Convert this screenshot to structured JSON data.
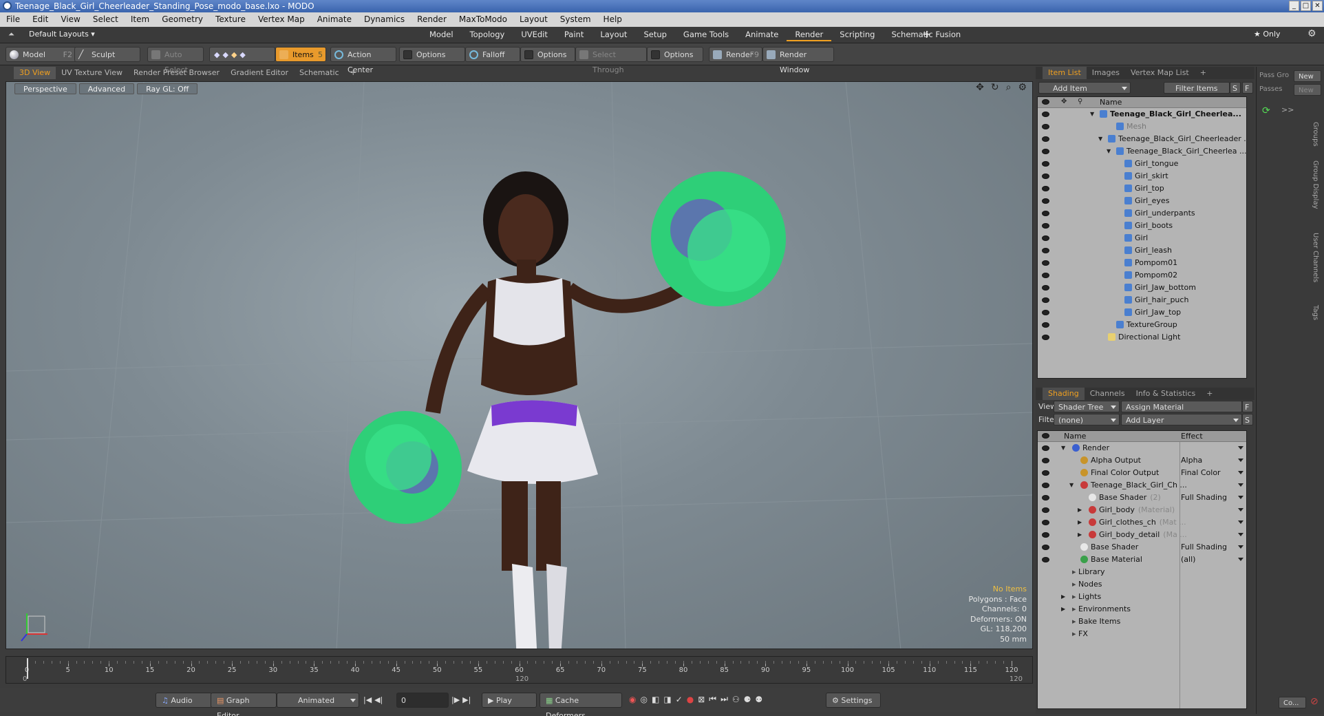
{
  "window": {
    "title": "Teenage_Black_Girl_Cheerleader_Standing_Pose_modo_base.lxo - MODO"
  },
  "menu": [
    "File",
    "Edit",
    "View",
    "Select",
    "Item",
    "Geometry",
    "Texture",
    "Vertex Map",
    "Animate",
    "Dynamics",
    "Render",
    "MaxToModo",
    "Layout",
    "System",
    "Help"
  ],
  "layouts": {
    "selector": "Default Layouts ▾",
    "tabs": [
      "Model",
      "Topology",
      "UVEdit",
      "Paint",
      "Layout",
      "Setup",
      "Game Tools",
      "Animate",
      "Render",
      "Scripting",
      "Schematic Fusion"
    ],
    "active": "Render",
    "plus": "+",
    "only": "★  Only"
  },
  "toolbar": {
    "model": "Model",
    "model_key": "F2",
    "sculpt": "Sculpt",
    "auto_select": "Auto Select",
    "items": "Items",
    "items_key": "5",
    "action_center": "Action Center",
    "options1": "Options",
    "falloff": "Falloff",
    "options2": "Options",
    "select_through": "Select Through",
    "options3": "Options",
    "render": "Render",
    "render_key": "F9",
    "render_window": "Render Window"
  },
  "viewport_tabs": [
    "3D View",
    "UV Texture View",
    "Render Preset Browser",
    "Gradient Editor",
    "Schematic"
  ],
  "viewport": {
    "perspective": "Perspective",
    "advanced": "Advanced",
    "raygl": "Ray GL: Off",
    "info": {
      "no_items": "No Items",
      "polygons": "Polygons : Face",
      "channels": "Channels: 0",
      "deformers": "Deformers: ON",
      "gl": "GL: 118,200",
      "focal": "50 mm"
    }
  },
  "timeline": {
    "ticks": [
      "0",
      "5",
      "10",
      "15",
      "20",
      "25",
      "30",
      "35",
      "40",
      "45",
      "50",
      "55",
      "60",
      "65",
      "70",
      "75",
      "80",
      "85",
      "90",
      "95",
      "100",
      "105",
      "110",
      "115",
      "120"
    ],
    "start": "0",
    "mid": "120",
    "end": "120"
  },
  "bottom": {
    "audio": "Audio",
    "graph_editor": "Graph Editor",
    "animated": "Animated",
    "frame": "0",
    "play": "Play",
    "cache": "Cache Deformers",
    "settings": "Settings"
  },
  "item_panel": {
    "tabs": [
      "Item List",
      "Images",
      "Vertex Map List"
    ],
    "add_item": "Add Item",
    "filter_items": "Filter Items",
    "s": "S",
    "f": "F",
    "col_name": "Name",
    "items": [
      {
        "label": "Teenage_Black_Girl_Cheerlea...",
        "indent": 0,
        "bold": true,
        "arrow": "▼"
      },
      {
        "label": "Mesh",
        "indent": 2,
        "dim": true,
        "arrow": ""
      },
      {
        "label": "Teenage_Black_Girl_Cheerleader ...",
        "indent": 1,
        "arrow": "▼"
      },
      {
        "label": "Teenage_Black_Girl_Cheerlea ...",
        "indent": 2,
        "arrow": "▼"
      },
      {
        "label": "Girl_tongue",
        "indent": 3,
        "arrow": ""
      },
      {
        "label": "Girl_skirt",
        "indent": 3,
        "arrow": ""
      },
      {
        "label": "Girl_top",
        "indent": 3,
        "arrow": ""
      },
      {
        "label": "Girl_eyes",
        "indent": 3,
        "arrow": ""
      },
      {
        "label": "Girl_underpants",
        "indent": 3,
        "arrow": ""
      },
      {
        "label": "Girl_boots",
        "indent": 3,
        "arrow": ""
      },
      {
        "label": "Girl",
        "indent": 3,
        "arrow": ""
      },
      {
        "label": "Girl_leash",
        "indent": 3,
        "arrow": ""
      },
      {
        "label": "Pompom01",
        "indent": 3,
        "arrow": ""
      },
      {
        "label": "Pompom02",
        "indent": 3,
        "arrow": ""
      },
      {
        "label": "Girl_Jaw_bottom",
        "indent": 3,
        "arrow": ""
      },
      {
        "label": "Girl_hair_puch",
        "indent": 3,
        "arrow": ""
      },
      {
        "label": "Girl_Jaw_top",
        "indent": 3,
        "arrow": ""
      },
      {
        "label": "TextureGroup",
        "indent": 2,
        "arrow": ""
      },
      {
        "label": "Directional Light",
        "indent": 1,
        "arrow": ""
      }
    ]
  },
  "shading_panel": {
    "tabs": [
      "Shading",
      "Channels",
      "Info & Statistics"
    ],
    "view_label": "View",
    "view_value": "Shader Tree",
    "assign_material": "Assign Material",
    "filter_label": "Filter",
    "filter_value": "(none)",
    "add_layer": "Add Layer",
    "f": "F",
    "s": "S",
    "col_name": "Name",
    "col_effect": "Effect",
    "rows": [
      {
        "label": "Render",
        "sub": "",
        "effect": "",
        "indent": 0,
        "arrow": "▼",
        "eye": true,
        "color": "#3a5fd0"
      },
      {
        "label": "Alpha Output",
        "sub": "",
        "effect": "Alpha",
        "indent": 1,
        "arrow": "",
        "eye": true,
        "color": "#c8942a"
      },
      {
        "label": "Final Color Output",
        "sub": "",
        "effect": "Final Color",
        "indent": 1,
        "arrow": "",
        "eye": true,
        "color": "#c8942a"
      },
      {
        "label": "Teenage_Black_Girl_Ch ...",
        "sub": "",
        "effect": "",
        "indent": 1,
        "arrow": "▼",
        "eye": true,
        "color": "#c83a3a"
      },
      {
        "label": "Base Shader",
        "sub": "(2)",
        "effect": "Full Shading",
        "indent": 2,
        "arrow": "",
        "eye": true,
        "color": "#e8e8e8"
      },
      {
        "label": "Girl_body",
        "sub": "(Material)",
        "effect": "",
        "indent": 2,
        "arrow": "▶",
        "eye": true,
        "color": "#c83a3a"
      },
      {
        "label": "Girl_clothes_ch",
        "sub": "(Mat ...",
        "effect": "",
        "indent": 2,
        "arrow": "▶",
        "eye": true,
        "color": "#c83a3a"
      },
      {
        "label": "Girl_body_detail",
        "sub": "(Ma ...",
        "effect": "",
        "indent": 2,
        "arrow": "▶",
        "eye": true,
        "color": "#c83a3a"
      },
      {
        "label": "Base Shader",
        "sub": "",
        "effect": "Full Shading",
        "indent": 1,
        "arrow": "",
        "eye": true,
        "color": "#e8e8e8"
      },
      {
        "label": "Base Material",
        "sub": "",
        "effect": "(all)",
        "indent": 1,
        "arrow": "",
        "eye": true,
        "color": "#3aa04a"
      },
      {
        "label": "Library",
        "sub": "",
        "effect": "",
        "indent": 0,
        "arrow": "",
        "eye": false,
        "color": ""
      },
      {
        "label": "Nodes",
        "sub": "",
        "effect": "",
        "indent": 0,
        "arrow": "",
        "eye": false,
        "color": ""
      },
      {
        "label": "Lights",
        "sub": "",
        "effect": "",
        "indent": 0,
        "arrow": "▶",
        "eye": false,
        "color": ""
      },
      {
        "label": "Environments",
        "sub": "",
        "effect": "",
        "indent": 0,
        "arrow": "▶",
        "eye": false,
        "color": ""
      },
      {
        "label": "Bake Items",
        "sub": "",
        "effect": "",
        "indent": 0,
        "arrow": "",
        "eye": false,
        "color": ""
      },
      {
        "label": "FX",
        "sub": "",
        "effect": "",
        "indent": 0,
        "arrow": "",
        "eye": false,
        "color": ""
      }
    ]
  },
  "far_right": {
    "pass_group": "Pass Gro",
    "passes": "Passes",
    "new1": "New",
    "new2": "New",
    "vert_tabs": [
      "Groups",
      "Group Display",
      "User Channels",
      "Tags"
    ],
    "bottom_btn": "Co..."
  }
}
